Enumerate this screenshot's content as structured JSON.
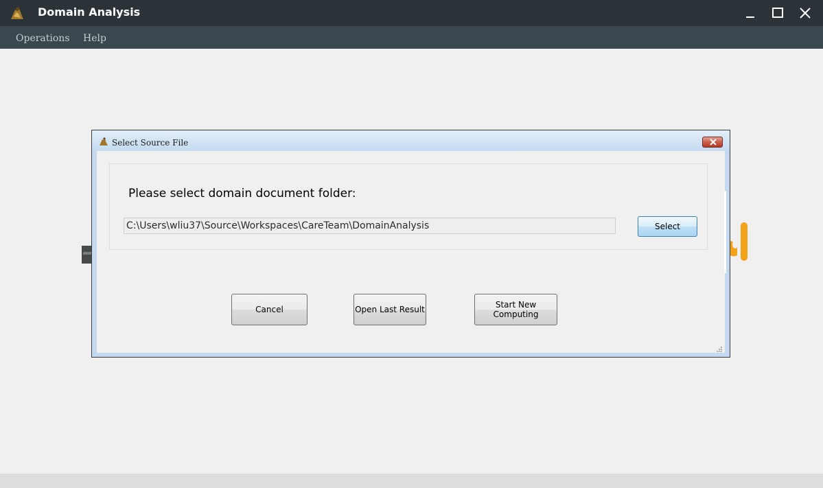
{
  "window": {
    "title": "Domain Analysis",
    "icon": "app-logo-icon",
    "controls": [
      "minimize-icon",
      "maximize-icon",
      "close-icon"
    ]
  },
  "menu": {
    "items": [
      {
        "label": "Operations"
      },
      {
        "label": "Help"
      }
    ]
  },
  "dialog": {
    "title": "Select Source File",
    "icon": "app-logo-icon",
    "prompt": "Please select domain document folder:",
    "path_value": "C:\\Users\\wliu37\\Source\\Workspaces\\CareTeam\\DomainAnalysis",
    "select_label": "Select",
    "buttons": {
      "cancel": "Cancel",
      "open_last": "Open Last Result",
      "start_new": "Start New Computing"
    }
  },
  "colors": {
    "titlebar_bg": "#2b3338",
    "menubar_bg": "#3b474e",
    "dialog_frame": "#c4d9ef",
    "close_red": "#c75a48",
    "accent_orange": "#f5a21b"
  }
}
